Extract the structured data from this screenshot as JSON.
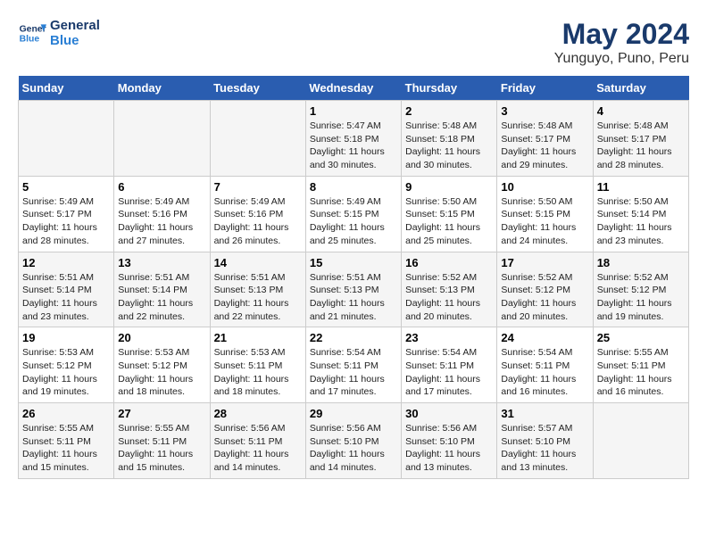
{
  "logo": {
    "line1": "General",
    "line2": "Blue"
  },
  "title": "May 2024",
  "subtitle": "Yunguyo, Puno, Peru",
  "days_header": [
    "Sunday",
    "Monday",
    "Tuesday",
    "Wednesday",
    "Thursday",
    "Friday",
    "Saturday"
  ],
  "weeks": [
    [
      {
        "day": "",
        "info": ""
      },
      {
        "day": "",
        "info": ""
      },
      {
        "day": "",
        "info": ""
      },
      {
        "day": "1",
        "info": "Sunrise: 5:47 AM\nSunset: 5:18 PM\nDaylight: 11 hours\nand 30 minutes."
      },
      {
        "day": "2",
        "info": "Sunrise: 5:48 AM\nSunset: 5:18 PM\nDaylight: 11 hours\nand 30 minutes."
      },
      {
        "day": "3",
        "info": "Sunrise: 5:48 AM\nSunset: 5:17 PM\nDaylight: 11 hours\nand 29 minutes."
      },
      {
        "day": "4",
        "info": "Sunrise: 5:48 AM\nSunset: 5:17 PM\nDaylight: 11 hours\nand 28 minutes."
      }
    ],
    [
      {
        "day": "5",
        "info": "Sunrise: 5:49 AM\nSunset: 5:17 PM\nDaylight: 11 hours\nand 28 minutes."
      },
      {
        "day": "6",
        "info": "Sunrise: 5:49 AM\nSunset: 5:16 PM\nDaylight: 11 hours\nand 27 minutes."
      },
      {
        "day": "7",
        "info": "Sunrise: 5:49 AM\nSunset: 5:16 PM\nDaylight: 11 hours\nand 26 minutes."
      },
      {
        "day": "8",
        "info": "Sunrise: 5:49 AM\nSunset: 5:15 PM\nDaylight: 11 hours\nand 25 minutes."
      },
      {
        "day": "9",
        "info": "Sunrise: 5:50 AM\nSunset: 5:15 PM\nDaylight: 11 hours\nand 25 minutes."
      },
      {
        "day": "10",
        "info": "Sunrise: 5:50 AM\nSunset: 5:15 PM\nDaylight: 11 hours\nand 24 minutes."
      },
      {
        "day": "11",
        "info": "Sunrise: 5:50 AM\nSunset: 5:14 PM\nDaylight: 11 hours\nand 23 minutes."
      }
    ],
    [
      {
        "day": "12",
        "info": "Sunrise: 5:51 AM\nSunset: 5:14 PM\nDaylight: 11 hours\nand 23 minutes."
      },
      {
        "day": "13",
        "info": "Sunrise: 5:51 AM\nSunset: 5:14 PM\nDaylight: 11 hours\nand 22 minutes."
      },
      {
        "day": "14",
        "info": "Sunrise: 5:51 AM\nSunset: 5:13 PM\nDaylight: 11 hours\nand 22 minutes."
      },
      {
        "day": "15",
        "info": "Sunrise: 5:51 AM\nSunset: 5:13 PM\nDaylight: 11 hours\nand 21 minutes."
      },
      {
        "day": "16",
        "info": "Sunrise: 5:52 AM\nSunset: 5:13 PM\nDaylight: 11 hours\nand 20 minutes."
      },
      {
        "day": "17",
        "info": "Sunrise: 5:52 AM\nSunset: 5:12 PM\nDaylight: 11 hours\nand 20 minutes."
      },
      {
        "day": "18",
        "info": "Sunrise: 5:52 AM\nSunset: 5:12 PM\nDaylight: 11 hours\nand 19 minutes."
      }
    ],
    [
      {
        "day": "19",
        "info": "Sunrise: 5:53 AM\nSunset: 5:12 PM\nDaylight: 11 hours\nand 19 minutes."
      },
      {
        "day": "20",
        "info": "Sunrise: 5:53 AM\nSunset: 5:12 PM\nDaylight: 11 hours\nand 18 minutes."
      },
      {
        "day": "21",
        "info": "Sunrise: 5:53 AM\nSunset: 5:11 PM\nDaylight: 11 hours\nand 18 minutes."
      },
      {
        "day": "22",
        "info": "Sunrise: 5:54 AM\nSunset: 5:11 PM\nDaylight: 11 hours\nand 17 minutes."
      },
      {
        "day": "23",
        "info": "Sunrise: 5:54 AM\nSunset: 5:11 PM\nDaylight: 11 hours\nand 17 minutes."
      },
      {
        "day": "24",
        "info": "Sunrise: 5:54 AM\nSunset: 5:11 PM\nDaylight: 11 hours\nand 16 minutes."
      },
      {
        "day": "25",
        "info": "Sunrise: 5:55 AM\nSunset: 5:11 PM\nDaylight: 11 hours\nand 16 minutes."
      }
    ],
    [
      {
        "day": "26",
        "info": "Sunrise: 5:55 AM\nSunset: 5:11 PM\nDaylight: 11 hours\nand 15 minutes."
      },
      {
        "day": "27",
        "info": "Sunrise: 5:55 AM\nSunset: 5:11 PM\nDaylight: 11 hours\nand 15 minutes."
      },
      {
        "day": "28",
        "info": "Sunrise: 5:56 AM\nSunset: 5:11 PM\nDaylight: 11 hours\nand 14 minutes."
      },
      {
        "day": "29",
        "info": "Sunrise: 5:56 AM\nSunset: 5:10 PM\nDaylight: 11 hours\nand 14 minutes."
      },
      {
        "day": "30",
        "info": "Sunrise: 5:56 AM\nSunset: 5:10 PM\nDaylight: 11 hours\nand 13 minutes."
      },
      {
        "day": "31",
        "info": "Sunrise: 5:57 AM\nSunset: 5:10 PM\nDaylight: 11 hours\nand 13 minutes."
      },
      {
        "day": "",
        "info": ""
      }
    ]
  ]
}
